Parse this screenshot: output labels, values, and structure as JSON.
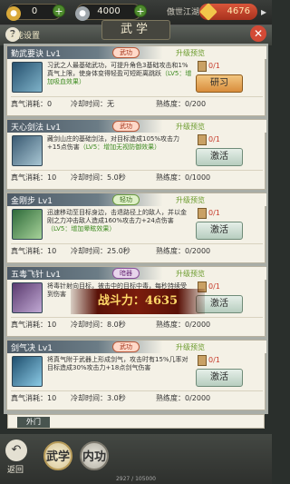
{
  "topbar": {
    "gold_value": "0",
    "silver_value": "4000",
    "server_name": "傲世江湖",
    "power_badge": "4676"
  },
  "header": {
    "settings_link": "技能设置",
    "title": "武学"
  },
  "skills": [
    {
      "name": "勤武要诀  Lv1",
      "school": "武功",
      "upgrade_label": "升级预览",
      "description": "习武之人最基础武功，可提升角色3基础攻击和1%真气上限，使身体变得轻盈可短距离跳跃",
      "lv5_text": "（LV5：增加吸血效果）",
      "book_count": "0/1",
      "action_label": "研习",
      "mp_cost": "真气消耗：0",
      "cooldown": "冷却时间：无",
      "proficiency": "熟练度：0/200"
    },
    {
      "name": "天心剑法  Lv1",
      "school": "武功",
      "upgrade_label": "升级预览",
      "description": "藏剑山庄的基础剑法，对目标造成105%攻击力+15点伤害",
      "lv5_text": "（LV5：增加无视防御效果）",
      "book_count": "0/1",
      "action_label": "激活",
      "mp_cost": "真气消耗：10",
      "cooldown": "冷却时间：5.0秒",
      "proficiency": "熟练度：0/1000"
    },
    {
      "name": "金刚步  Lv1",
      "school": "轻功",
      "upgrade_label": "升级预览",
      "description": "迅速移动至目标身边，击退路径上的敌人，并以金刚之力冲击敌人造成160%攻击力+24点伤害",
      "lv5_text": "（LV5：增加晕眩效果）",
      "book_count": "0/1",
      "action_label": "激活",
      "mp_cost": "真气消耗：10",
      "cooldown": "冷却时间：25.0秒",
      "proficiency": "熟练度：0/2000"
    },
    {
      "name": "五毒飞针  Lv1",
      "school": "暗器",
      "upgrade_label": "升级预览",
      "description": "将毒针射向目标，被击中的目标中毒，每秒持续受到伤害",
      "lv5_text": "",
      "book_count": "0/1",
      "action_label": "激活",
      "mp_cost": "真气消耗：10",
      "cooldown": "冷却时间：8.0秒",
      "proficiency": "熟练度：0/2000"
    },
    {
      "name": "剑气决  Lv1",
      "school": "武功",
      "upgrade_label": "升级预览",
      "description": "将真气附于武器上形成剑气，攻击时有15%几率对目标造成30%攻击力+18点剑气伤害",
      "lv5_text": "",
      "book_count": "0/1",
      "action_label": "激活",
      "mp_cost": "真气消耗：10",
      "cooldown": "冷却时间：3.0秒",
      "proficiency": "熟练度：0/2000"
    }
  ],
  "overlay": {
    "battle_power": "战斗力：4635"
  },
  "tabs": {
    "outer_label": "外门"
  },
  "bottom_nav": {
    "back_label": "返回",
    "wuxue_label": "武学",
    "neigong_label": "内功"
  },
  "footer": {
    "exp_text": "2927 / 105000"
  },
  "colors": {
    "accent_orange": "#d98d3c",
    "school_red": "#a3351c",
    "upgrade_green": "#6b9b2c"
  }
}
